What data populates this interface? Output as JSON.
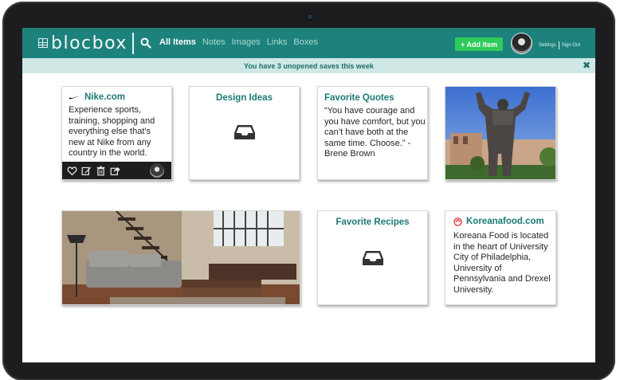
{
  "header": {
    "logo_text": "blocbox",
    "nav": [
      "All Items",
      "Notes",
      "Images",
      "Links",
      "Boxes"
    ],
    "active_nav": "All Items",
    "add_button": "+ Add Item",
    "settings": "Settings",
    "sign_out": "Sign Out"
  },
  "notice": {
    "text": "You have 3 unopened saves this week",
    "close_symbol": "✖"
  },
  "cards": {
    "nike": {
      "title": "Nike.com",
      "body": "Experience sports, training, shopping and everything else that's new at Nike from any country in the world.",
      "actions": [
        "heart-icon",
        "edit-icon",
        "trash-icon",
        "share-icon"
      ]
    },
    "design": {
      "title": "Design Ideas",
      "icon": "inbox-tray-icon"
    },
    "quotes": {
      "title": "Favorite Quotes",
      "body": "“You have courage and you have comfort, but you can’t have both at the same time. Choose.” -Brene Brown"
    },
    "statue": {
      "image": "bronze-statue-photo"
    },
    "room": {
      "image": "loft-living-room-photo"
    },
    "recipes": {
      "title": "Favorite Recipes",
      "icon": "inbox-tray-icon"
    },
    "korea": {
      "title": "Koreanafood.com",
      "body": "Koreana Food is located in the heart of University City of Philadelphia, University of Pennsylvania and Drexel University."
    }
  },
  "colors": {
    "topbar": "#1e827c",
    "accent_text": "#1c7a74",
    "add_button": "#2ecc5a",
    "notice_bg": "#cfe8e5"
  }
}
